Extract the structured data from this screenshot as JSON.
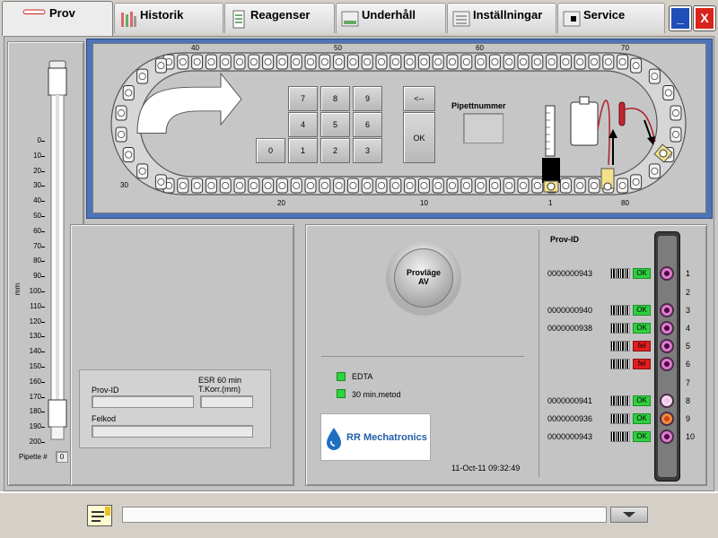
{
  "tabs": [
    {
      "label": "Prov",
      "active": true,
      "icon": "tube-icon"
    },
    {
      "label": "Historik",
      "active": false,
      "icon": "history-icon"
    },
    {
      "label": "Reagenser",
      "active": false,
      "icon": "reagent-icon"
    },
    {
      "label": "Underhåll",
      "active": false,
      "icon": "maintenance-icon"
    },
    {
      "label": "Inställningar",
      "active": false,
      "icon": "settings-icon"
    },
    {
      "label": "Service",
      "active": false,
      "icon": "service-icon"
    }
  ],
  "window": {
    "minimize_label": "_",
    "close_label": "X"
  },
  "carousel": {
    "top_scale": [
      "40",
      "50",
      "60",
      "70"
    ],
    "bottom_scale": [
      "20",
      "10",
      "1",
      "80"
    ],
    "left_scale": "30",
    "keypad": [
      "7",
      "8",
      "9",
      "4",
      "5",
      "6",
      "0",
      "1",
      "2",
      "3"
    ],
    "backspace_label": "<--",
    "ok_label": "OK",
    "pipette_number_label": "Pipettnummer"
  },
  "pipette_gauge": {
    "unit": "mm",
    "ticks": [
      "0",
      "10",
      "20",
      "30",
      "40",
      "50",
      "60",
      "70",
      "80",
      "90",
      "100",
      "110",
      "120",
      "130",
      "140",
      "150",
      "160",
      "170",
      "180",
      "190",
      "200"
    ],
    "pipette_label": "Pipette #",
    "pipette_value": "0"
  },
  "result_form": {
    "prov_id_label": "Prov-ID",
    "esr_label_line1": "ESR 60 min",
    "esr_label_line2": "T.Korr.(mm)",
    "felkod_label": "Felkod"
  },
  "mode_button": {
    "line1": "Provläge",
    "line2": "AV"
  },
  "indicators": [
    {
      "label": "EDTA",
      "color": "#2cd63a"
    },
    {
      "label": "30 min.metod",
      "color": "#2cd63a"
    }
  ],
  "logo": {
    "text": "RR Mechatronics",
    "color": "#1f5fa8"
  },
  "datetime": "11-Oct-11 09:32:49",
  "rack": {
    "header": "Prov-ID",
    "rows": [
      {
        "id": "0000000943",
        "status": "OK",
        "slot": "1",
        "cap": "pink"
      },
      {
        "id": "",
        "status": "",
        "slot": "2",
        "cap": "none"
      },
      {
        "id": "0000000940",
        "status": "OK",
        "slot": "3",
        "cap": "pink"
      },
      {
        "id": "0000000938",
        "status": "OK",
        "slot": "4",
        "cap": "pink"
      },
      {
        "id": "",
        "status": "fel",
        "slot": "5",
        "cap": "pink"
      },
      {
        "id": "",
        "status": "fel",
        "slot": "6",
        "cap": "pink"
      },
      {
        "id": "",
        "status": "",
        "slot": "7",
        "cap": "none"
      },
      {
        "id": "0000000941",
        "status": "OK",
        "slot": "8",
        "cap": "lightpink"
      },
      {
        "id": "0000000936",
        "status": "OK",
        "slot": "9",
        "cap": "orange"
      },
      {
        "id": "0000000943",
        "status": "OK",
        "slot": "10",
        "cap": "pink"
      }
    ]
  },
  "bottom": {
    "input_value": "",
    "dropdown_icon": "chevron-down-icon",
    "notes_icon": "notes-icon"
  }
}
